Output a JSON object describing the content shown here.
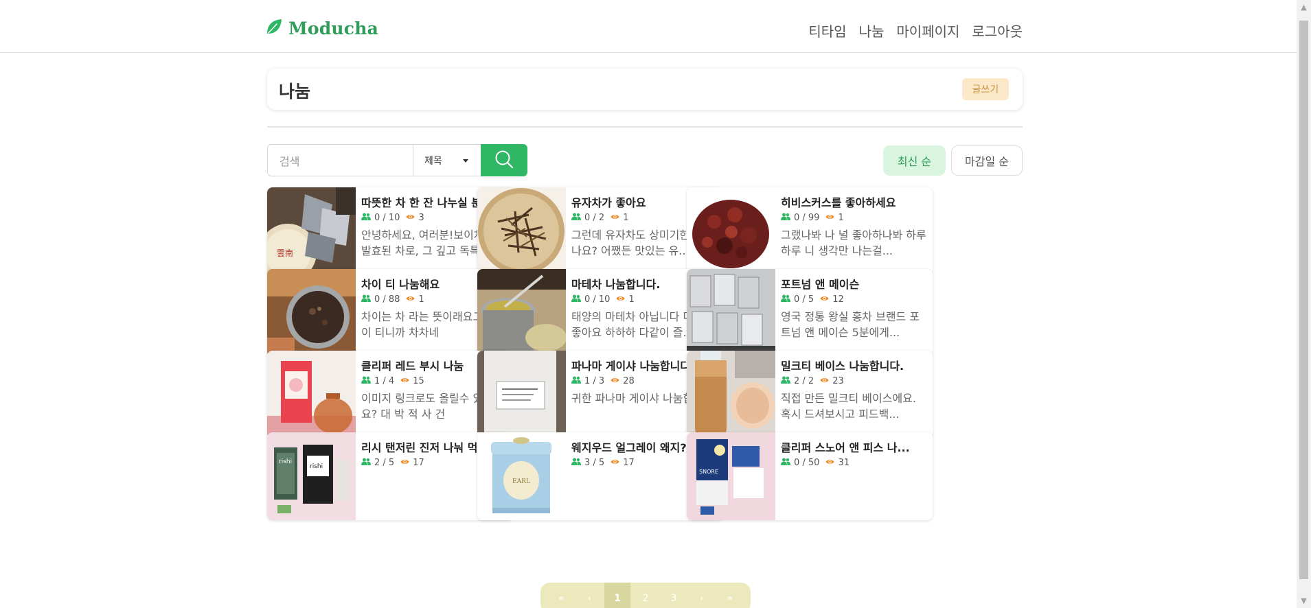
{
  "app": {
    "brand": "Moducha",
    "brand_icon": "leaf-icon",
    "accent": "#2fb766"
  },
  "nav": {
    "items": [
      "티타임",
      "나눔",
      "마이페이지",
      "로그아웃"
    ]
  },
  "header": {
    "title": "나눔",
    "write_label": "글쓰기"
  },
  "search": {
    "placeholder": "검색",
    "field_selected": "제목"
  },
  "sort": {
    "latest": "최신 순",
    "deadline": "마감일 순"
  },
  "cards": [
    {
      "title": "따뜻한 차 한 잔 나누실 분...",
      "people": "0 / 10",
      "views": "3",
      "desc": "안녕하세요, 여러분!보이차는 발효된 차로, 그 깊고 독특...",
      "thumb": "puer-cakes"
    },
    {
      "title": "유자차가 좋아요",
      "people": "0 / 2",
      "views": "1",
      "desc": "그런데 유자차도 상미기한이 있나요? 어쨌든 맛있는 유...",
      "thumb": "dried-leaves-plate"
    },
    {
      "title": "히비스커스를 좋아하세요",
      "people": "0 / 99",
      "views": "1",
      "desc": "그랬나봐 나 널 좋아하나봐 하루하루 니 생각만 나는걸...",
      "thumb": "hibiscus"
    },
    {
      "title": "차이 티 나눔해요",
      "people": "0 / 88",
      "views": "1",
      "desc": "차이는 차 라는 뜻이래요그럼 차이 티니까 차차네",
      "thumb": "chai-tin"
    },
    {
      "title": "마테차 나눔합니다.",
      "people": "0 / 10",
      "views": "1",
      "desc": "태양의 마테차 아닙니다 마테차 좋아요 하하하 다같이 즐...",
      "thumb": "mate-cup"
    },
    {
      "title": "포트넘 앤 메이슨",
      "people": "0 / 5",
      "views": "12",
      "desc": "영국 정통 왕실 홍차 브랜드 포트넘 앤 메이슨  5분에게...",
      "thumb": "tea-sachets"
    },
    {
      "title": "클리퍼 레드 부시 나눔",
      "people": "1 / 4",
      "views": "15",
      "desc": "이미지 링크로도 올릴수 있네요? 대 박 적 사 건",
      "thumb": "redbush-box"
    },
    {
      "title": "파나마 게이샤 나눔합니다...",
      "people": "1 / 3",
      "views": "28",
      "desc": "귀한 파나마 게이샤 나눔합니다",
      "thumb": "coffee-bag"
    },
    {
      "title": "밀크티 베이스 나눔합니다.",
      "people": "2 / 2",
      "views": "23",
      "desc": " 직접 만든 밀크티 베이스에요. 혹시 드셔보시고 피드백...",
      "thumb": "milk-tea-bottle"
    },
    {
      "title": "리시 탠저린 진저 나눠 먹...",
      "people": "2 / 5",
      "views": "17",
      "desc": "",
      "thumb": "rishi-pack"
    },
    {
      "title": "웨지우드 얼그레이 왜지?",
      "people": "3 / 5",
      "views": "17",
      "desc": "",
      "thumb": "wedgwood-tin"
    },
    {
      "title": "클리퍼 스노어 앤 피스 나...",
      "people": "0 / 50",
      "views": "31",
      "desc": "",
      "thumb": "snore-peace-box"
    }
  ],
  "pagination": {
    "first": "«",
    "prev": "‹",
    "pages": [
      "1",
      "2",
      "3"
    ],
    "current": "1",
    "next": "›",
    "last": "»"
  }
}
